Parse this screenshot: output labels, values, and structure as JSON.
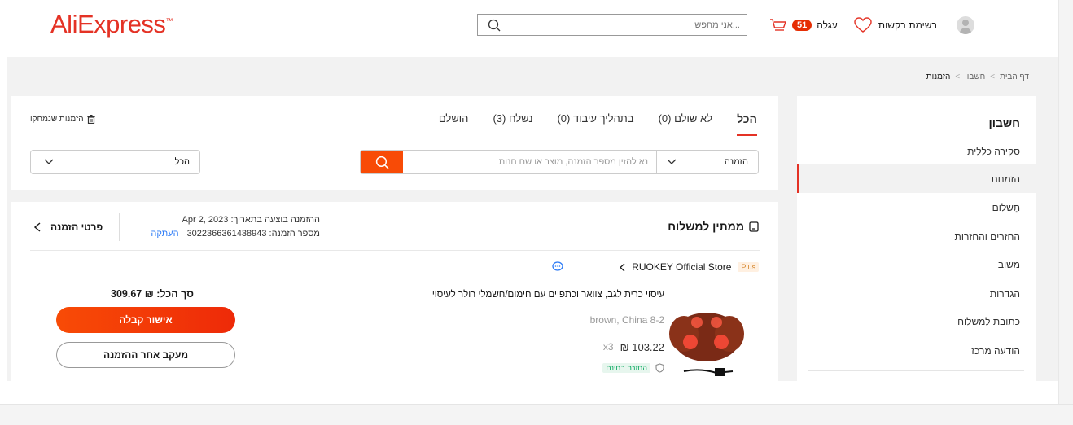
{
  "header": {
    "logo": "AliExpress",
    "search_placeholder": "...אני מחפש",
    "cart_label": "עגלה",
    "cart_count": "51",
    "wishlist_label": "רשימת בקשות"
  },
  "breadcrumb": [
    "דף הבית",
    "חשבון",
    "הזמנות"
  ],
  "sidebar": {
    "title": "חשבון",
    "items": [
      "סקירה כללית",
      "הזמנות",
      "תַשלום",
      "החזרים והחזרות",
      "משוב",
      "הגדרות",
      "כתובת למשלוח",
      "הודעה מרכז"
    ],
    "active_index": 1
  },
  "orders": {
    "tabs": [
      "הכל",
      "לא שולם (0)",
      "בתהליך עיבוד (0)",
      "נשלח (3)",
      "הושלם"
    ],
    "active_tab": 0,
    "deleted_label": "הזמנות שנמחקו",
    "filter_type": "הזמנה",
    "filter_placeholder": "נא להזין מספר הזמנה, מוצר או שם חנות",
    "period_select": "הכל"
  },
  "order": {
    "status": "ממתין למשלוח",
    "date_line": "ההזמנה בוצעה בתאריך: Apr 2, 2023",
    "number_line": "מספר הזמנה: 3022366361438943",
    "copy_label": "העתקה",
    "details_label": "פרטי הזמנה",
    "store_badge": "Plus",
    "store_name": "RUOKEY Official Store",
    "product_title": "עיסוי כרית לגב, צוואר וכתפיים עם חימום/חשמלי רולר לעיסוי",
    "variant": "brown, China 8-2",
    "price": "103.22 ₪",
    "quantity": "x3",
    "free_return": "החזרה בחינם",
    "total": "סך הכל: ₪ 309.67",
    "confirm_button": "אישור קבלה",
    "track_button": "מעקב אחר ההזמנה"
  },
  "colors": {
    "brand": "#e43225",
    "accent": "#f84b06",
    "link": "#2e7cf6"
  }
}
